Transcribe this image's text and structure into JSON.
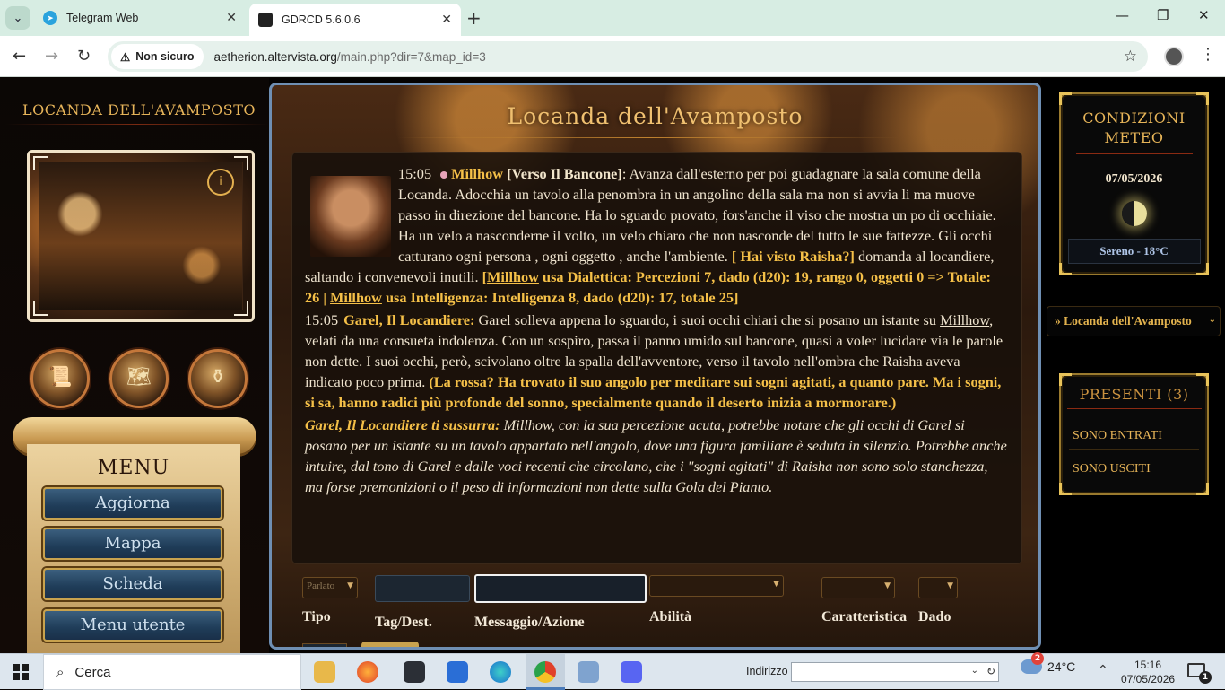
{
  "browser": {
    "tabs": [
      {
        "title": "Telegram Web",
        "favicon": "telegram-icon"
      },
      {
        "title": "GDRCD 5.6.0.6",
        "favicon": "gdrcd-icon"
      }
    ],
    "security_label": "Non sicuro",
    "url_host": "aetherion.altervista.org",
    "url_path": "/main.php?dir=7&map_id=3"
  },
  "left": {
    "location_title": "LOCANDA DELL'AVAMPOSTO",
    "menu_title": "MENU",
    "menu_items": [
      "Aggiorna",
      "Mappa",
      "Scheda",
      "Menu utente"
    ]
  },
  "chat": {
    "title": "Locanda dell'Avamposto",
    "msg1": {
      "time": "15:05",
      "speaker": "Millhow",
      "tag": "[Verso Il Bancone]",
      "text": ": Avanza dall'esterno per poi guadagnare la sala comune della Locanda. Adocchia un tavolo alla penombra in un angolino della sala ma non si avvia li ma muove passo in direzione del bancone. Ha lo sguardo provato, fors'anche il viso che mostra un po di occhiaie. Ha un velo a nasconderne il volto, un velo chiaro che non nasconde del tutto le sue fattezze. Gli occhi catturano ogni persona , ogni oggetto , anche l'ambiente.",
      "quote": "[ Hai visto Raisha?]",
      "text2": " domanda al locandiere, saltando i convenevoli inutili.",
      "roll_open": "[",
      "roll_name1": "Millhow",
      "roll_text1": " usa Dialettica: Percezioni 7, dado (d20): 19, rango 0, oggetti 0 => Totale: 26 | ",
      "roll_name2": "Millhow",
      "roll_text2": " usa Intelligenza: Intelligenza 8, dado (d20): 17, totale 25]"
    },
    "msg2": {
      "time": "15:05",
      "speaker": "Garel, Il Locandiere:",
      "text_a": " Garel solleva appena lo sguardo, i suoi occhi chiari che si posano un istante su ",
      "mention": "Millhow",
      "text_b": ", velati da una consueta indolenza. Con un sospiro, passa il panno umido sul bancone, quasi a voler lucidare via le parole non dette. I suoi occhi, però, scivolano oltre la spalla dell'avventore, verso il tavolo nell'ombra che Raisha aveva indicato poco prima.",
      "quote": " (La rossa? Ha trovato il suo angolo per meditare sui sogni agitati, a quanto pare. Ma i sogni, si sa, hanno radici più profonde del sonno, specialmente quando il deserto inizia a mormorare.)"
    },
    "whisper": {
      "label": "Garel, Il Locandiere ti sussurra:",
      "text": " Millhow, con la sua percezione acuta, potrebbe notare che gli occhi di Garel si posano per un istante su un tavolo appartato nell'angolo, dove una figura familiare è seduta in silenzio. Potrebbe anche intuire, dal tono di Garel e dalle voci recenti che circolano, che i \"sogni agitati\" di Raisha non sono solo stanchezza, ma forse premonizioni o il peso di informazioni non dette sulla Gola del Pianto."
    },
    "form": {
      "type_value": "Parlato",
      "labels": {
        "tipo": "Tipo",
        "tag": "Tag/Dest.",
        "msg": "Messaggio/Azione",
        "abilita": "Abilità",
        "car": "Caratteristica",
        "dado": "Dado"
      }
    }
  },
  "right": {
    "meteo_title": "CONDIZIONI METEO",
    "date": "07/05/2026",
    "condition": "Sereno - 18°C",
    "location_select": "» Locanda dell'Avamposto",
    "presenti_title": "PRESENTI (3)",
    "entered": "SONO ENTRATI",
    "left": "SONO USCITI"
  },
  "taskbar": {
    "search_label": "Cerca",
    "address_label": "Indirizzo",
    "weather_badge": "2",
    "temperature": "24°C",
    "time": "15:16",
    "date": "07/05/2026",
    "notifications": "1"
  }
}
